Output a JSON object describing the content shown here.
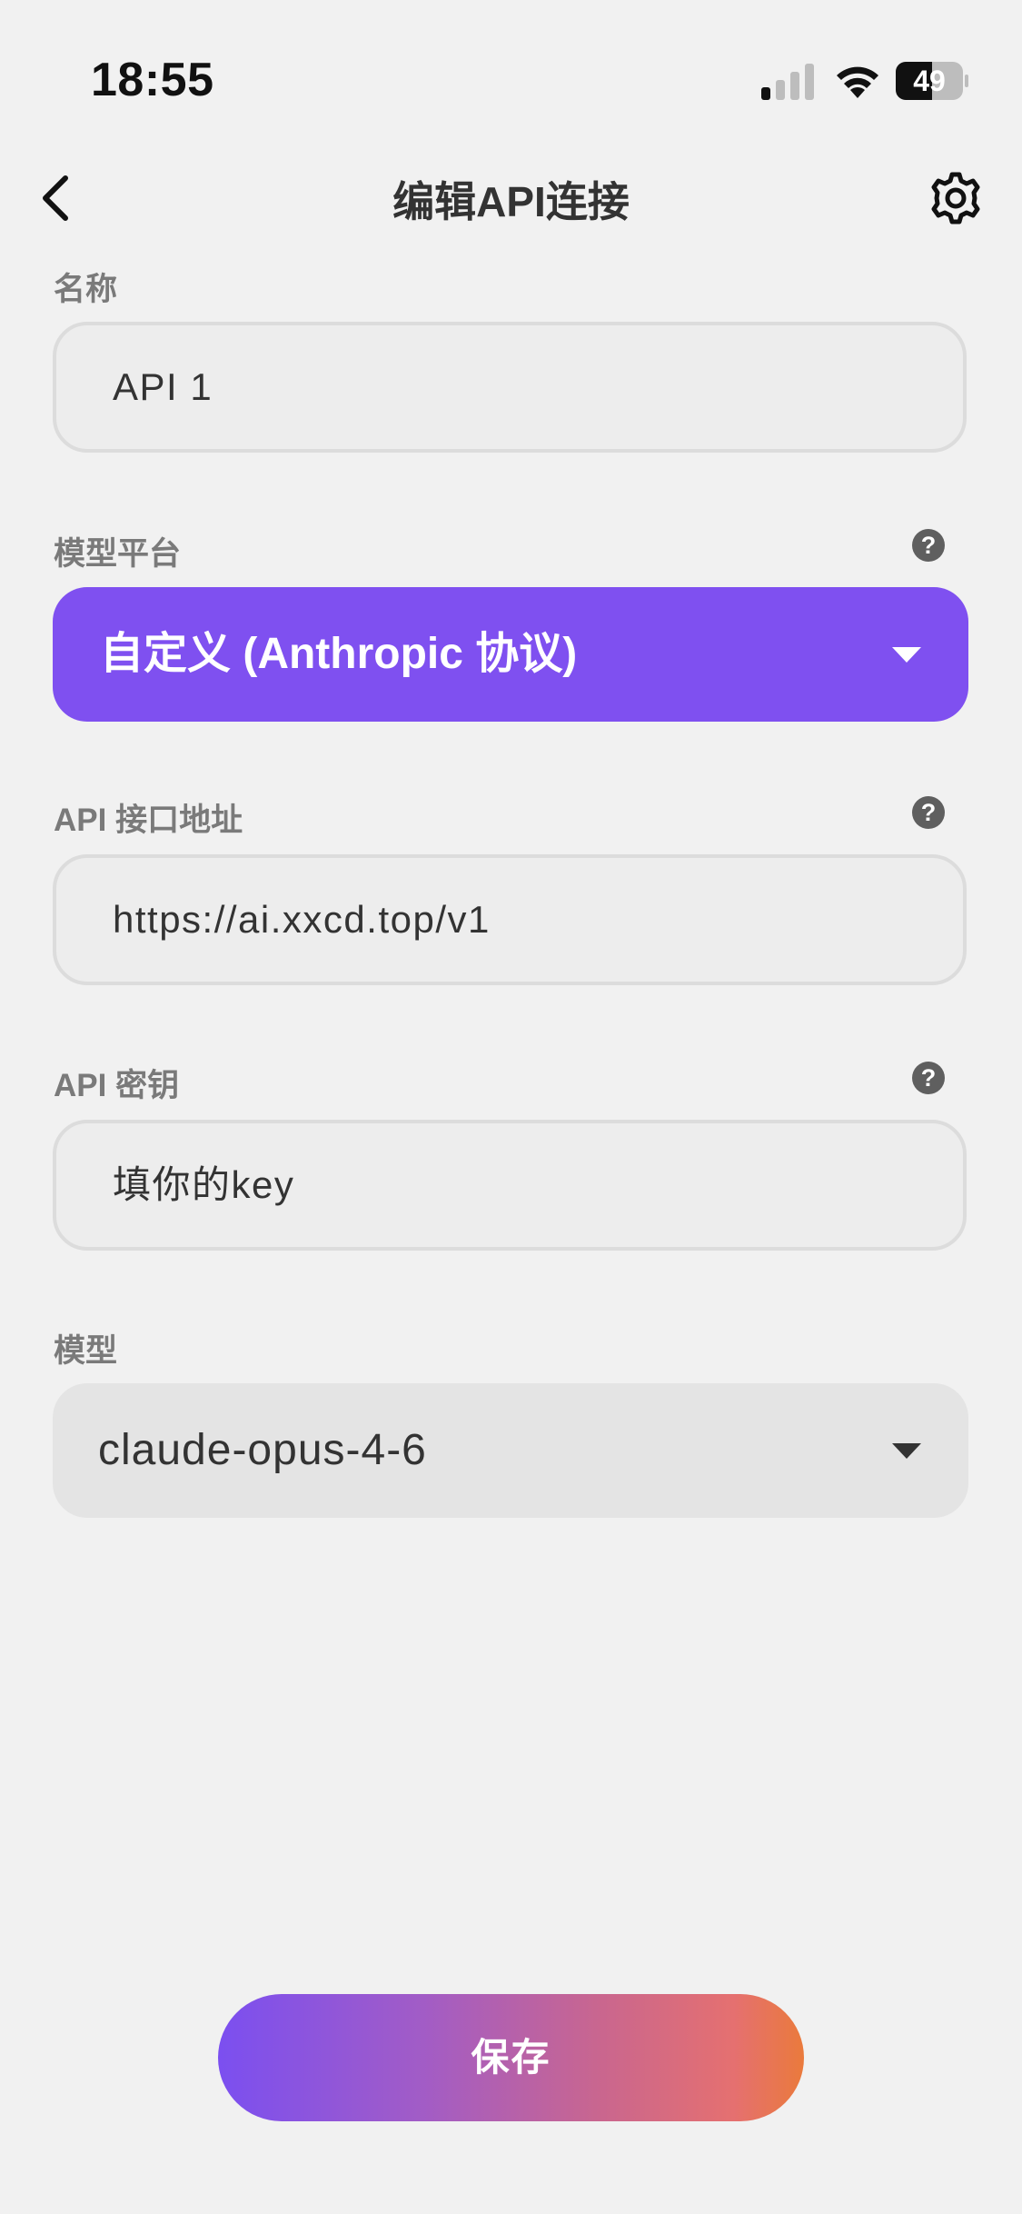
{
  "status_bar": {
    "time": "18:55",
    "battery": "49",
    "signal_icon": "cellular-signal-icon",
    "wifi_icon": "wifi-icon",
    "battery_icon": "battery-icon"
  },
  "nav": {
    "title": "编辑API连接",
    "back_icon": "chevron-left-icon",
    "settings_icon": "gear-icon"
  },
  "form": {
    "name": {
      "label": "名称",
      "value": "API 1"
    },
    "platform": {
      "label": "模型平台",
      "value": "自定义 (Anthropic 协议)",
      "help": "?"
    },
    "endpoint": {
      "label": "API 接口地址",
      "value": "https://ai.xxcd.top/v1",
      "help": "?"
    },
    "api_key": {
      "label": "API 密钥",
      "value": "填你的key",
      "help": "?"
    },
    "model": {
      "label": "模型",
      "value": "claude-opus-4-6"
    }
  },
  "actions": {
    "save_label": "保存"
  },
  "colors": {
    "accent": "#7f50f0",
    "gradient_start": "#7b4ff0",
    "gradient_end": "#ea7a3c",
    "background": "#f1f1f1"
  }
}
